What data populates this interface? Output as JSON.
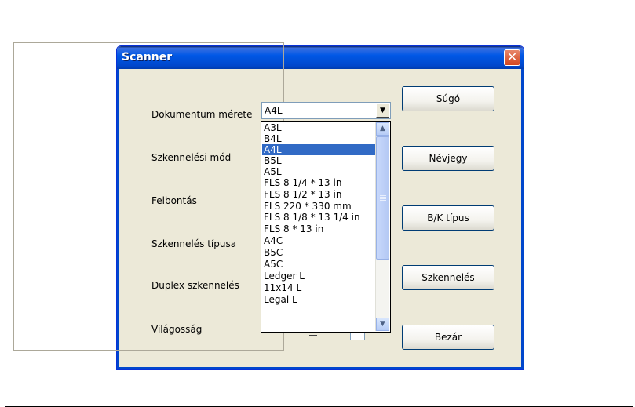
{
  "window": {
    "title": "Scanner",
    "close_glyph": "✕",
    "close_icon": "close-icon"
  },
  "labels": {
    "doc_size": "Dokumentum mérete",
    "scan_mode": "Szkennelési mód",
    "resolution": "Felbontás",
    "scan_type": "Szkennelés típusa",
    "duplex": "Duplex szkennelés",
    "brightness": "Világosság"
  },
  "doc_size_combo": {
    "value": "A4L",
    "arrow_glyph": "▼"
  },
  "doc_size_list": {
    "items": [
      "A3L",
      "B4L",
      "A4L",
      "B5L",
      "A5L",
      "FLS 8 1/4 * 13 in",
      "FLS 8 1/2 * 13 in",
      "FLS 220 * 330 mm",
      "FLS 8 1/8 * 13 1/4 in",
      "FLS 8 * 13 in",
      "A4C",
      "B5C",
      "A5C",
      "Ledger L",
      "11x14 L",
      "Legal L"
    ],
    "selected": "A4L",
    "scroll_up_glyph": "▲",
    "scroll_down_glyph": "▼"
  },
  "buttons": {
    "help": "Súgó",
    "about": "Névjegy",
    "bw_type": "B/K típus",
    "scan": "Szkennelés",
    "close": "Bezár"
  },
  "colors": {
    "titlebar": "#0058e6",
    "selection": "#316ac5",
    "dialog_bg": "#ece9d8",
    "close_button": "#d2451e"
  }
}
